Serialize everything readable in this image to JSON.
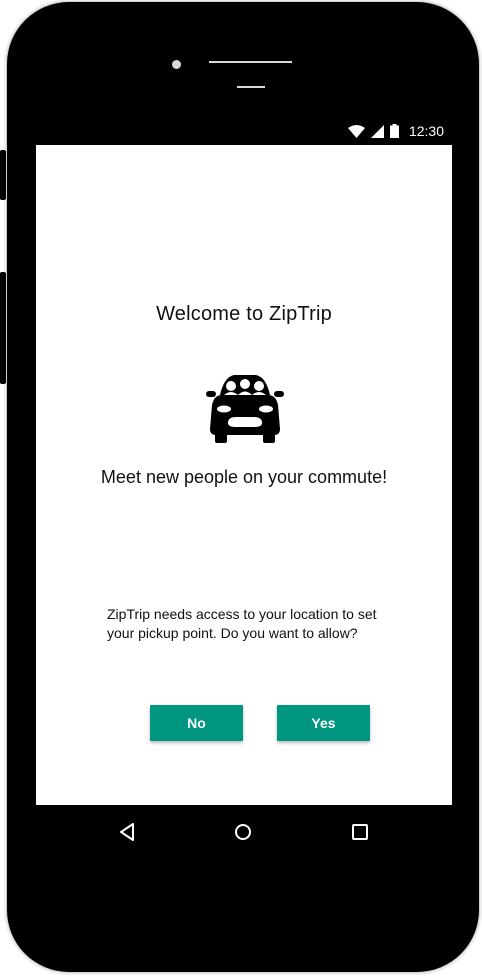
{
  "status_bar": {
    "time": "12:30",
    "icons": [
      "wifi-icon",
      "signal-icon",
      "battery-icon"
    ]
  },
  "screen": {
    "welcome_title": "Welcome to ZipTrip",
    "hero_icon": "car-icon",
    "tagline": "Meet new people on your commute!",
    "permission_text": "ZipTrip needs access to your location to set your pickup point. Do you want to allow?",
    "buttons": {
      "no_label": "No",
      "yes_label": "Yes"
    }
  },
  "nav_bar": {
    "icons": [
      "back-icon",
      "home-icon",
      "recents-icon"
    ]
  },
  "colors": {
    "accent": "#00967f",
    "device": "#000000",
    "screen_bg": "#ffffff"
  }
}
